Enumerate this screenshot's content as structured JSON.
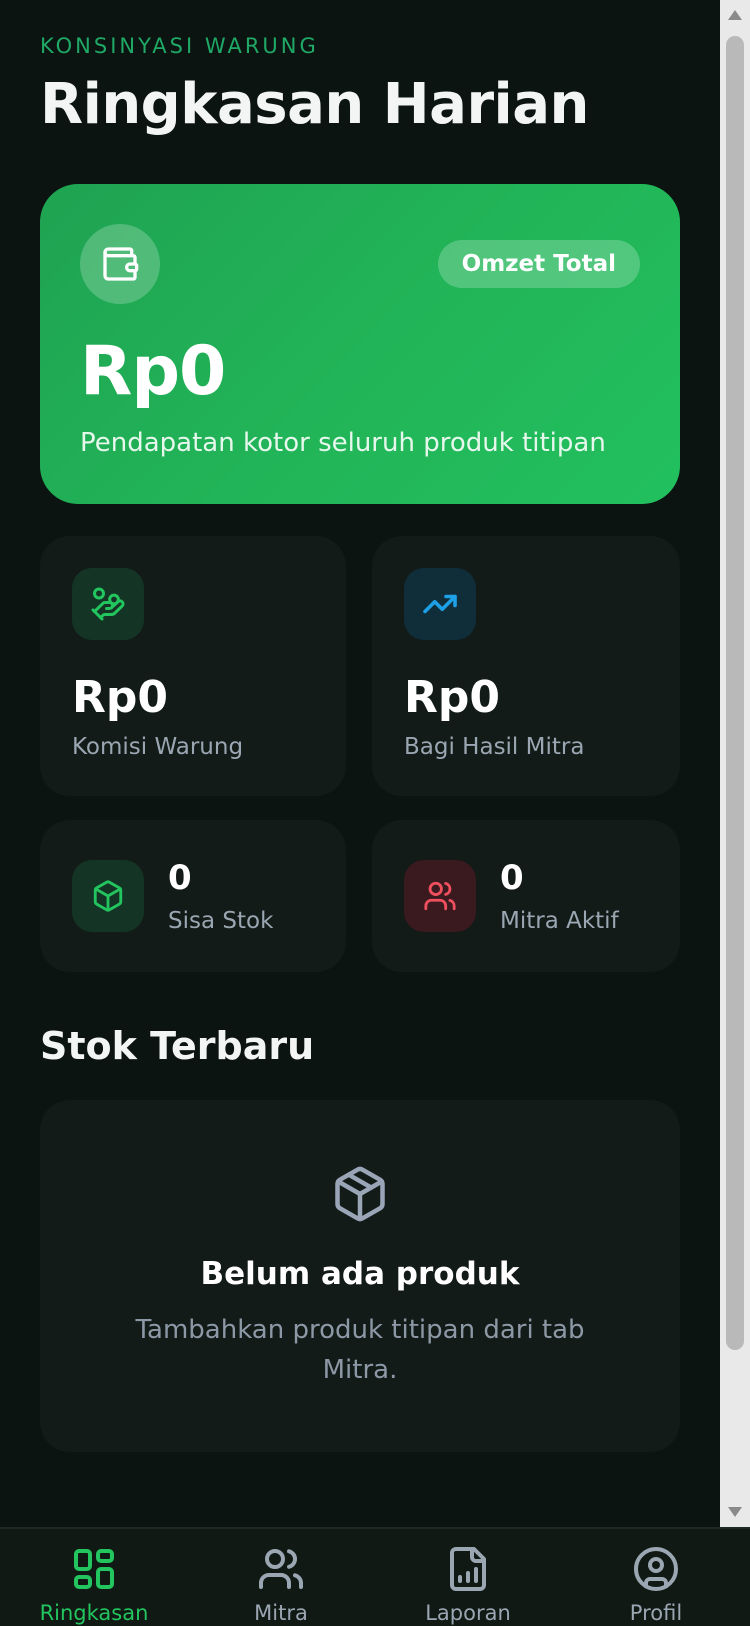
{
  "header": {
    "eyebrow": "KONSINYASI WARUNG",
    "title": "Ringkasan Harian"
  },
  "hero": {
    "badge": "Omzet Total",
    "value": "Rp0",
    "description": "Pendapatan kotor seluruh produk titipan",
    "icon": "wallet-icon"
  },
  "stats": {
    "komisi": {
      "value": "Rp0",
      "label": "Komisi Warung",
      "icon": "hand-coins-icon"
    },
    "bagi_hasil": {
      "value": "Rp0",
      "label": "Bagi Hasil Mitra",
      "icon": "trending-up-icon"
    },
    "sisa_stok": {
      "value": "0",
      "label": "Sisa Stok",
      "icon": "package-icon"
    },
    "mitra_aktif": {
      "value": "0",
      "label": "Mitra Aktif",
      "icon": "users-icon"
    }
  },
  "stok_section": {
    "title": "Stok Terbaru",
    "empty_title": "Belum ada produk",
    "empty_description": "Tambahkan produk titipan dari tab Mitra.",
    "icon": "package-icon"
  },
  "nav": {
    "items": [
      {
        "label": "Ringkasan",
        "icon": "layout-grid-icon",
        "active": true
      },
      {
        "label": "Mitra",
        "icon": "users-icon",
        "active": false
      },
      {
        "label": "Laporan",
        "icon": "file-chart-icon",
        "active": false
      },
      {
        "label": "Profil",
        "icon": "user-circle-icon",
        "active": false
      }
    ]
  },
  "colors": {
    "background": "#0b1410",
    "accent": "#22c55e",
    "card": "#121b17",
    "eyebrow": "#1fa866",
    "muted_text": "#9aa6b2"
  }
}
